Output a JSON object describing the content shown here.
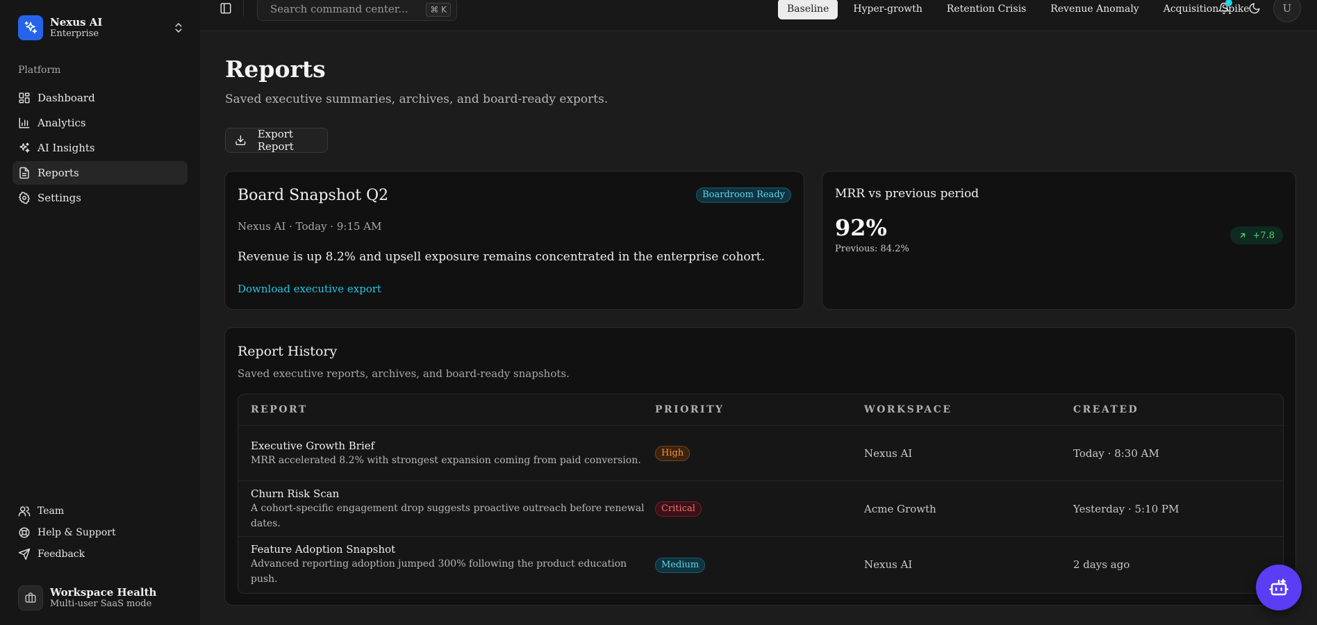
{
  "brand": {
    "name": "Nexus AI",
    "plan": "Enterprise"
  },
  "sidebar": {
    "heading": "Platform",
    "items": [
      {
        "label": "Dashboard",
        "icon": "dashboard-icon"
      },
      {
        "label": "Analytics",
        "icon": "bar-chart-icon"
      },
      {
        "label": "AI Insights",
        "icon": "sparkles-icon"
      },
      {
        "label": "Reports",
        "icon": "file-icon",
        "active": true
      },
      {
        "label": "Settings",
        "icon": "gear-icon"
      }
    ],
    "bottom_items": [
      {
        "label": "Team",
        "icon": "users-icon"
      },
      {
        "label": "Help & Support",
        "icon": "lifebuoy-icon"
      },
      {
        "label": "Feedback",
        "icon": "send-icon"
      }
    ],
    "workspace": {
      "title": "Workspace Health",
      "subtitle": "Multi-user SaaS mode"
    }
  },
  "topbar": {
    "search_placeholder": "Search command center...",
    "shortcut": "⌘ K",
    "scenarios": [
      "Baseline",
      "Hyper-growth",
      "Retention Crisis",
      "Revenue Anomaly",
      "Acquisition Spike"
    ],
    "active_scenario": "Baseline",
    "avatar_initial": "U"
  },
  "page": {
    "title": "Reports",
    "subtitle": "Saved executive summaries, archives, and board-ready exports.",
    "export_label": "Export Report"
  },
  "board_card": {
    "title": "Board Snapshot Q2",
    "badge": "Boardroom Ready",
    "meta": "Nexus AI · Today · 9:15 AM",
    "summary": "Revenue is up 8.2% and upsell exposure remains concentrated in the enterprise cohort.",
    "link": "Download executive export"
  },
  "mrr_card": {
    "title": "MRR vs previous period",
    "value": "92%",
    "previous": "Previous: 84.2%",
    "delta": "+7.8"
  },
  "history": {
    "title": "Report History",
    "subtitle": "Saved executive reports, archives, and board-ready snapshots.",
    "columns": [
      "REPORT",
      "PRIORITY",
      "WORKSPACE",
      "CREATED"
    ],
    "rows": [
      {
        "name": "Executive Growth Brief",
        "desc": "MRR accelerated 8.2% with strongest expansion coming from paid conversion.",
        "priority": "High",
        "workspace": "Nexus AI",
        "created": "Today · 8:30 AM"
      },
      {
        "name": "Churn Risk Scan",
        "desc": "A cohort-specific engagement drop suggests proactive outreach before renewal dates.",
        "priority": "Critical",
        "workspace": "Acme Growth",
        "created": "Yesterday · 5:10 PM"
      },
      {
        "name": "Feature Adoption Snapshot",
        "desc": "Advanced reporting adoption jumped 300% following the product education push.",
        "priority": "Medium",
        "workspace": "Nexus AI",
        "created": "2 days ago"
      }
    ]
  },
  "colors": {
    "accent": "#2563eb",
    "cyan": "#22c5e6",
    "bot": "#5b3df5",
    "positive": "#4ade80"
  }
}
